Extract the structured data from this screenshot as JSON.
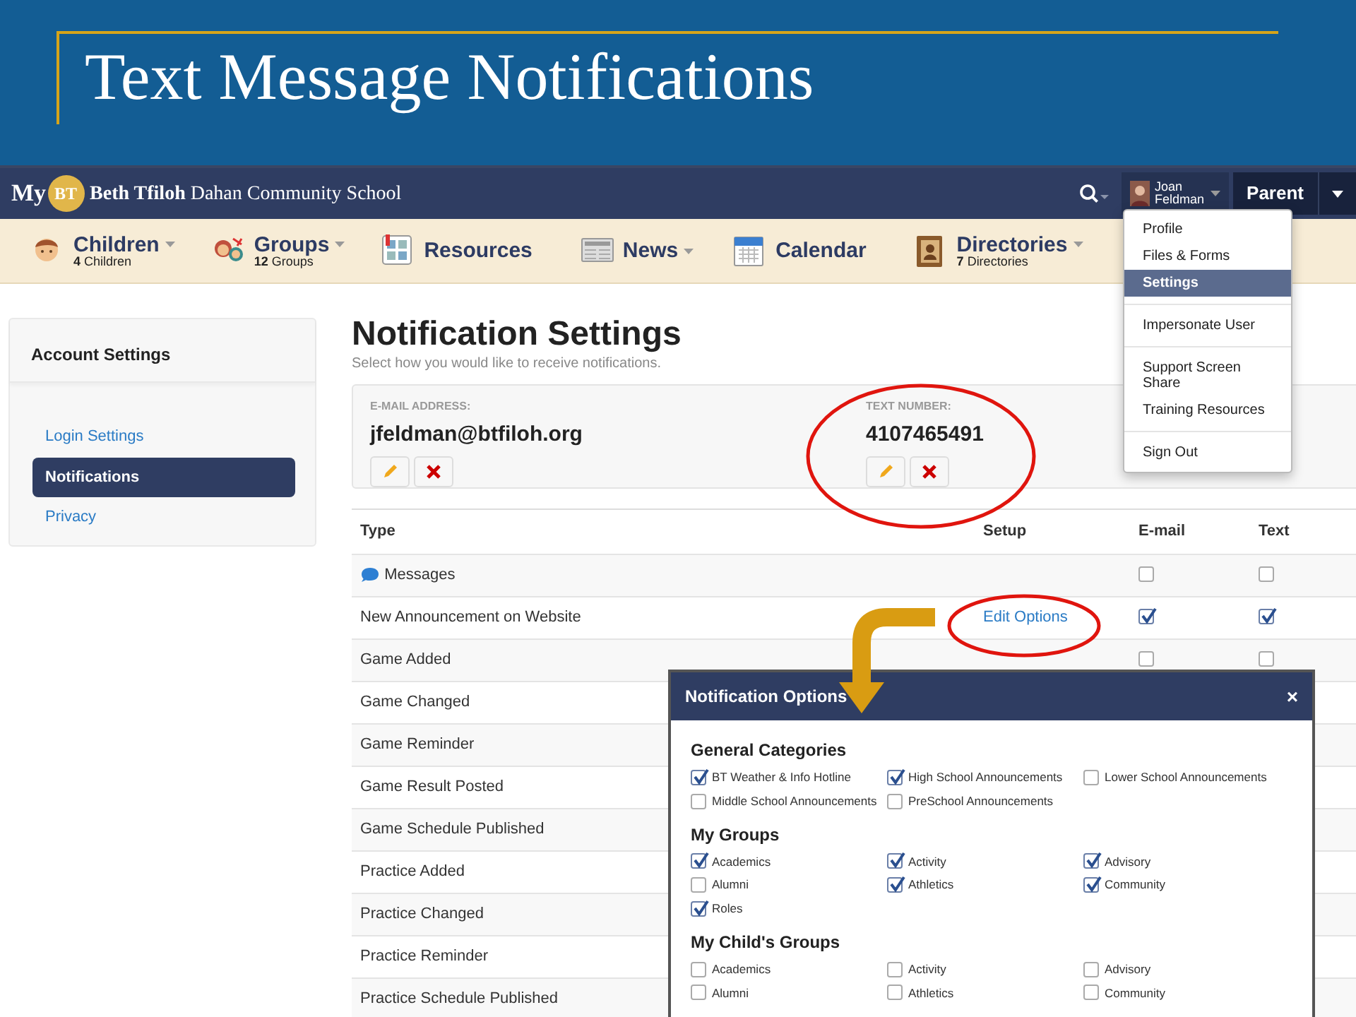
{
  "slide": {
    "title": "Text Message Notifications"
  },
  "topbar": {
    "logo_text": "My",
    "logo_badge": "BT",
    "school": "**Beth Tfiloh** Dahan Community School",
    "user_first": "Joan",
    "user_last": "Feldman",
    "role_button": "Parent"
  },
  "main_nav": [
    {
      "title": "Children",
      "subtitle": "**4** Children",
      "has_menu": true
    },
    {
      "title": "Groups",
      "subtitle": "**12** Groups",
      "has_menu": true
    },
    {
      "title": "Resources",
      "has_menu": false
    },
    {
      "title": "News",
      "has_menu": true
    },
    {
      "title": "Calendar",
      "has_menu": false
    },
    {
      "title": "Directories",
      "subtitle": "**7** Directories",
      "has_menu": true
    }
  ],
  "user_menu": {
    "expanded": true,
    "sections": [
      {
        "items": [
          {
            "label": "Profile",
            "selected": false
          },
          {
            "label": "Files & Forms",
            "selected": false
          },
          {
            "label": "Settings",
            "selected": true
          }
        ]
      },
      {
        "items": [
          {
            "label": "Impersonate User",
            "selected": false
          }
        ]
      },
      {
        "items": [
          {
            "label": "Support Screen Share",
            "selected": false
          },
          {
            "label": "Training Resources",
            "selected": false
          }
        ]
      },
      {
        "items": [
          {
            "label": "Sign Out",
            "selected": false
          }
        ]
      }
    ]
  },
  "sidebar": {
    "title": "Account Settings",
    "items": [
      {
        "label": "Login Settings",
        "selected": false
      },
      {
        "label": "Notifications",
        "selected": true
      },
      {
        "label": "Privacy",
        "selected": false
      }
    ]
  },
  "page": {
    "title": "Notification Settings",
    "subtitle": "Select how you would like to receive notifications.",
    "contacts": [
      {
        "label": "E-MAIL ADDRESS:",
        "value": "jfeldman@btfiloh.org"
      },
      {
        "label": "TEXT NUMBER:",
        "value": "4107465491"
      }
    ]
  },
  "table": {
    "columns": [
      "Type",
      "Setup",
      "E-mail",
      "Text"
    ],
    "rows": [
      {
        "type": "Messages",
        "kind": "message",
        "email": false,
        "text": false
      },
      {
        "type": "New Announcement on Website",
        "kind": "plain",
        "setup": "Edit Options",
        "email": true,
        "text": true
      },
      {
        "type": "Game Added",
        "kind": "plain",
        "email": false,
        "text": false
      },
      {
        "type": "Game Changed",
        "kind": "plain"
      },
      {
        "type": "Game Reminder",
        "kind": "plain"
      },
      {
        "type": "Game Result Posted",
        "kind": "plain"
      },
      {
        "type": "Game Schedule Published",
        "kind": "plain"
      },
      {
        "type": "Practice Added",
        "kind": "plain"
      },
      {
        "type": "Practice Changed",
        "kind": "plain"
      },
      {
        "type": "Practice Reminder",
        "kind": "plain"
      },
      {
        "type": "Practice Schedule Published",
        "kind": "plain"
      }
    ]
  },
  "modal": {
    "title": "Notification Options",
    "close": "×",
    "sections": [
      {
        "heading": "General Categories",
        "items": [
          {
            "label": "BT Weather & Info Hotline",
            "checked": true
          },
          {
            "label": "High School Announcements",
            "checked": true
          },
          {
            "label": "Lower School Announcements",
            "checked": false
          },
          {
            "label": "Middle School Announcements",
            "checked": false
          },
          {
            "label": "PreSchool Announcements",
            "checked": false
          }
        ]
      },
      {
        "heading": "My Groups",
        "items": [
          {
            "label": "Academics",
            "checked": true
          },
          {
            "label": "Activity",
            "checked": true
          },
          {
            "label": "Advisory",
            "checked": true
          },
          {
            "label": "Alumni",
            "checked": false
          },
          {
            "label": "Athletics",
            "checked": true
          },
          {
            "label": "Community",
            "checked": true
          },
          {
            "label": "Roles",
            "checked": true
          }
        ]
      },
      {
        "heading": "My Child's Groups",
        "items": [
          {
            "label": "Academics",
            "checked": false
          },
          {
            "label": "Activity",
            "checked": false
          },
          {
            "label": "Advisory",
            "checked": false
          },
          {
            "label": "Alumni",
            "checked": false
          },
          {
            "label": "Athletics",
            "checked": false
          },
          {
            "label": "Community",
            "checked": false
          }
        ]
      }
    ]
  }
}
